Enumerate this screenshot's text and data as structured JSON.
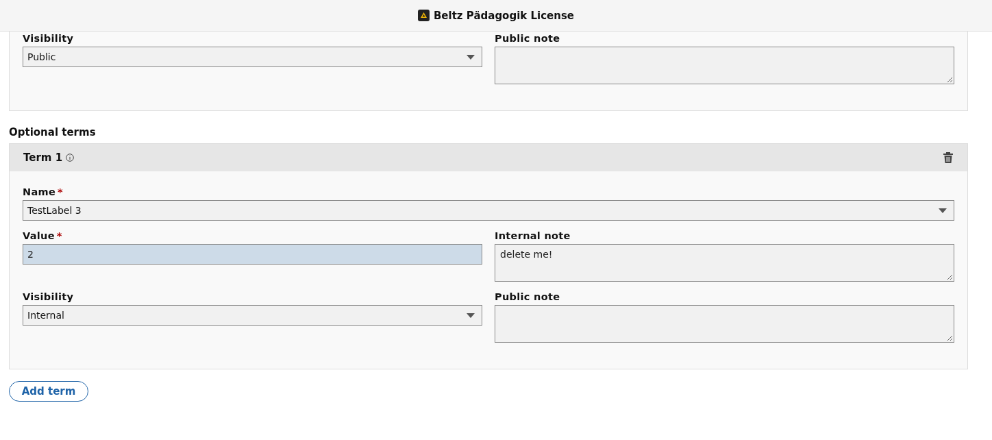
{
  "header": {
    "title": "Beltz Pädagogik License"
  },
  "top_section": {
    "rows": [
      [
        {
          "label": "Visibility",
          "kind": "select",
          "value": "Public"
        },
        {
          "label": "Public note",
          "kind": "textarea"
        }
      ]
    ]
  },
  "optional_terms": {
    "title": "Optional terms",
    "terms": [
      {
        "title": "Term 1",
        "rows": [
          [
            {
              "label": "Name",
              "required_mark": "*",
              "kind": "select",
              "value": "TestLabel 3"
            }
          ],
          [
            {
              "label": "Value",
              "required_mark": "*",
              "kind": "input",
              "value": "2",
              "focused": true
            },
            {
              "label": "Internal note",
              "kind": "textarea",
              "value": "delete me!"
            }
          ],
          [
            {
              "label": "Visibility",
              "kind": "select",
              "value": "Internal"
            },
            {
              "label": "Public note",
              "kind": "textarea"
            }
          ]
        ]
      }
    ],
    "add_button": "Add term"
  }
}
